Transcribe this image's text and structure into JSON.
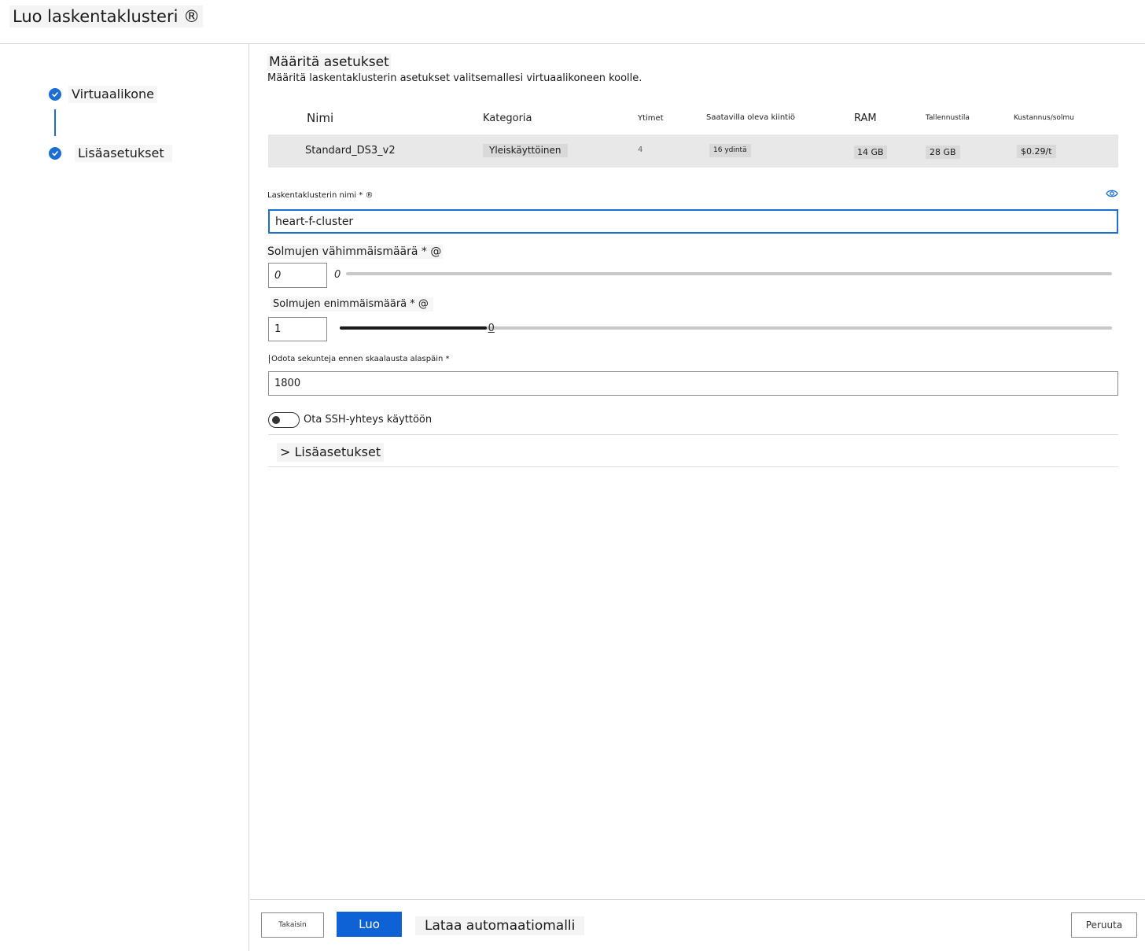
{
  "header": {
    "title": "Luo laskentaklusteri ®"
  },
  "wizard": {
    "steps": [
      {
        "label": "Virtuaalikone"
      },
      {
        "label": "Lisäasetukset"
      }
    ]
  },
  "settings": {
    "title": "Määritä asetukset",
    "description": "Määritä laskentaklusterin asetukset valitsemallesi virtuaalikoneen koolle.",
    "table": {
      "columns": [
        "Nimi",
        "Kategoria",
        "Ytimet",
        "Saatavilla oleva kiintiö",
        "RAM",
        "Tallennustila",
        "Kustannus/solmu"
      ],
      "row": {
        "name": "Standard_DS3_v2",
        "category": "Yleiskäyttöinen",
        "cores": "4",
        "quota": "16 ydintä",
        "ram": "14 GB",
        "storage": "28 GB",
        "cost": "$0.29/t"
      }
    },
    "cluster_name": {
      "label": "Laskentaklusterin nimi * ®",
      "value": "heart-f-cluster"
    },
    "min_nodes": {
      "label": "Solmujen vähimmäismäärä * @",
      "value": "0",
      "slider_label": "0",
      "slider_fraction": 0
    },
    "max_nodes": {
      "label": "Solmujen enimmäismäärä * @",
      "value": "1",
      "slider_label": "0",
      "slider_fraction": 0.19
    },
    "idle_seconds": {
      "label": "Odota sekunteja ennen skaalausta alaspäin *",
      "value": "1800"
    },
    "ssh": {
      "label": "Ota SSH-yhteys käyttöön",
      "enabled": false
    },
    "advanced": {
      "label": "> Lisäasetukset"
    }
  },
  "footer": {
    "back": "Takaisin",
    "create": "Luo",
    "download": "Lataa automaatiomalli",
    "cancel": "Peruuta"
  },
  "colors": {
    "accent": "#1a6fd0",
    "primary_button": "#0f62d6"
  }
}
